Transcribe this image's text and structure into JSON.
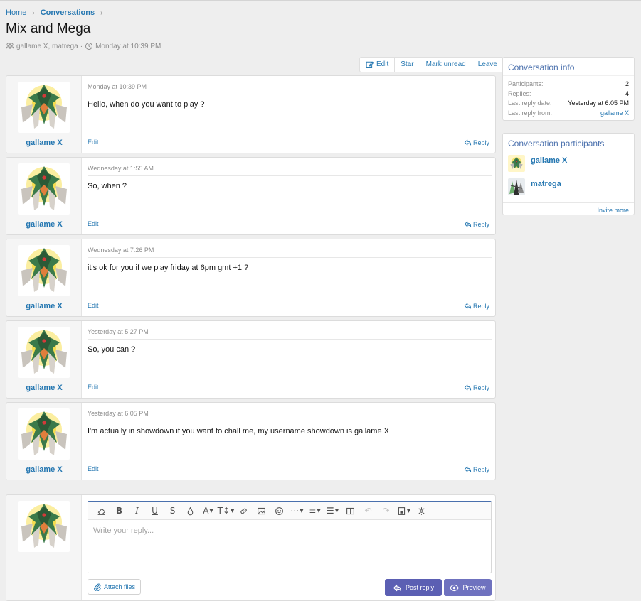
{
  "breadcrumb": {
    "home": "Home",
    "current": "Conversations"
  },
  "page": {
    "title": "Mix and Mega",
    "participants": "gallame X, matrega",
    "separator": "·",
    "date": "Monday at 10:39 PM"
  },
  "actions": {
    "edit": "Edit",
    "star": "Star",
    "mark_unread": "Mark unread",
    "leave": "Leave"
  },
  "messages": [
    {
      "user": "gallame X",
      "time": "Monday at 10:39 PM",
      "text": "Hello, when do you want to play ?",
      "edit": "Edit",
      "reply": "Reply"
    },
    {
      "user": "gallame X",
      "time": "Wednesday at 1:55 AM",
      "text": "So, when ?",
      "edit": "Edit",
      "reply": "Reply"
    },
    {
      "user": "gallame X",
      "time": "Wednesday at 7:26 PM",
      "text": "it's ok for you if we play friday at 6pm gmt +1 ?",
      "edit": "Edit",
      "reply": "Reply"
    },
    {
      "user": "gallame X",
      "time": "Yesterday at 5:27 PM",
      "text": "So, you can ?",
      "edit": "Edit",
      "reply": "Reply"
    },
    {
      "user": "gallame X",
      "time": "Yesterday at 6:05 PM",
      "text": "I'm actually in showdown if you want to chall me, my username showdown is gallame X",
      "edit": "Edit",
      "reply": "Reply"
    }
  ],
  "sidebar": {
    "info_title": "Conversation info",
    "info": [
      {
        "label": "Participants:",
        "value": "2"
      },
      {
        "label": "Replies:",
        "value": "4"
      },
      {
        "label": "Last reply date:",
        "value": "Yesterday at 6:05 PM"
      },
      {
        "label": "Last reply from:",
        "value": "gallame X"
      }
    ],
    "participants_title": "Conversation participants",
    "participants": [
      {
        "name": "gallame X"
      },
      {
        "name": "matrega"
      }
    ],
    "invite": "Invite more"
  },
  "reply_box": {
    "placeholder": "Write your reply...",
    "attach": "Attach files",
    "post": "Post reply",
    "preview": "Preview"
  },
  "colors": {
    "link": "#2577b1",
    "accent": "#4a70ad",
    "button": "#5b5fb3"
  }
}
